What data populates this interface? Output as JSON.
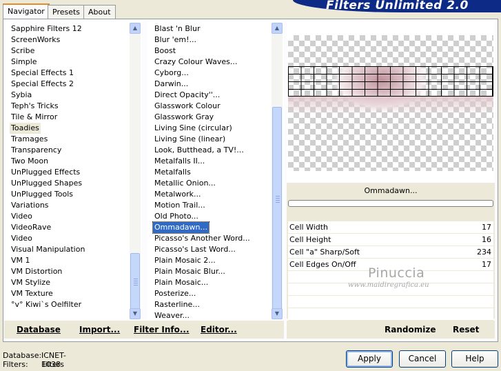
{
  "app": {
    "banner_title": "Filters Unlimited 2.0"
  },
  "tabs": [
    {
      "label": "Navigator",
      "active": true
    },
    {
      "label": "Presets",
      "active": false
    },
    {
      "label": "About",
      "active": false
    }
  ],
  "categories": {
    "items": [
      "Sapphire Filters 12",
      "ScreenWorks",
      "Scribe",
      "Simple",
      "Special Effects 1",
      "Special Effects 2",
      "Sybia",
      "Teph's Tricks",
      "Tile & Mirror",
      "Toadies",
      "Tramages",
      "Transparency",
      "Two Moon",
      "UnPlugged Effects",
      "UnPlugged Shapes",
      "UnPlugged Tools",
      "Variations",
      "Video",
      "VideoRave",
      "Video",
      "Visual Manipulation",
      "VM 1",
      "VM Distortion",
      "VM Stylize",
      "VM Texture",
      "°v° Kiwi`s Oelfilter"
    ],
    "selected": "Toadies"
  },
  "filters": {
    "items": [
      "Blast 'n Blur",
      "Blur 'em!...",
      "Boost",
      "Crazy Colour Waves...",
      "Cyborg...",
      "Darwin...",
      "Direct Opacity''...",
      "Glasswork Colour",
      "Glasswork Gray",
      "Living Sine (circular)",
      "Living Sine (linear)",
      "Look, Butthead, a TV!...",
      "Metalfalls II...",
      "Metalfalls",
      "Metallic Onion...",
      "Metalwork...",
      "Motion Trail...",
      "Old Photo...",
      "Ommadawn...",
      "Picasso's Another Word...",
      "Picasso's Last Word...",
      "Plain Mosaic 2...",
      "Plain Mosaic Blur...",
      "Plain Mosaic...",
      "Posterize...",
      "Rasterline...",
      "Weaver..."
    ],
    "selected": "Ommadawn..."
  },
  "toolbar": {
    "database": "Database",
    "import": "Import...",
    "filter_info": "Filter Info...",
    "editor": "Editor...",
    "randomize": "Randomize",
    "reset": "Reset"
  },
  "preview": {
    "filter_name": "Ommadawn...",
    "progress": 0
  },
  "params": [
    {
      "label": "Cell Width",
      "value": "17"
    },
    {
      "label": "Cell Height",
      "value": "16"
    },
    {
      "label": "Cell \"a\" Sharp/Soft",
      "value": "234"
    },
    {
      "label": "Cell Edges On/Off",
      "value": "17"
    }
  ],
  "watermark": {
    "line1": "Pinuccia",
    "line2": "www.maidiregrafica.eu"
  },
  "status": {
    "database_label": "Database:",
    "database_value": "ICNET-Filters",
    "filters_label": "Filters:",
    "filters_value": "1038"
  },
  "buttons": {
    "apply": "Apply",
    "cancel": "Cancel",
    "help": "Help"
  }
}
